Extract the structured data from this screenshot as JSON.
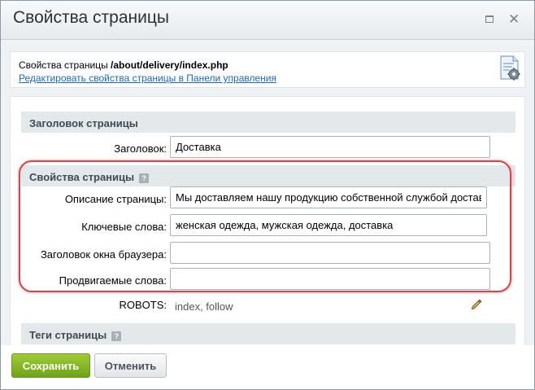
{
  "dialog": {
    "title": "Свойства страницы"
  },
  "info": {
    "prefix": "Свойства страницы ",
    "path": "/about/delivery/index.php",
    "link": "Редактировать свойства страницы в Панели управления"
  },
  "sections": {
    "header_title": "Заголовок страницы",
    "props_title": "Свойства страницы",
    "tags_title": "Теги страницы",
    "help_glyph": "?"
  },
  "fields": {
    "title_label": "Заголовок:",
    "title_value": "Доставка",
    "description_label": "Описание страницы:",
    "description_value": "Мы доставляем нашу продукцию собственной службой доставки",
    "keywords_label": "Ключевые слова:",
    "keywords_value": "женская одежда, мужская одежда, доставка",
    "browser_title_label": "Заголовок окна браузера:",
    "browser_title_value": "",
    "promoted_label": "Продвигаемые слова:",
    "promoted_value": "",
    "robots_label": "ROBOTS:",
    "robots_value": "index, follow"
  },
  "buttons": {
    "save": "Сохранить",
    "cancel": "Отменить"
  },
  "colors": {
    "highlight": "#d9434c",
    "save_button": "#7cb122",
    "link": "#2067b0"
  }
}
